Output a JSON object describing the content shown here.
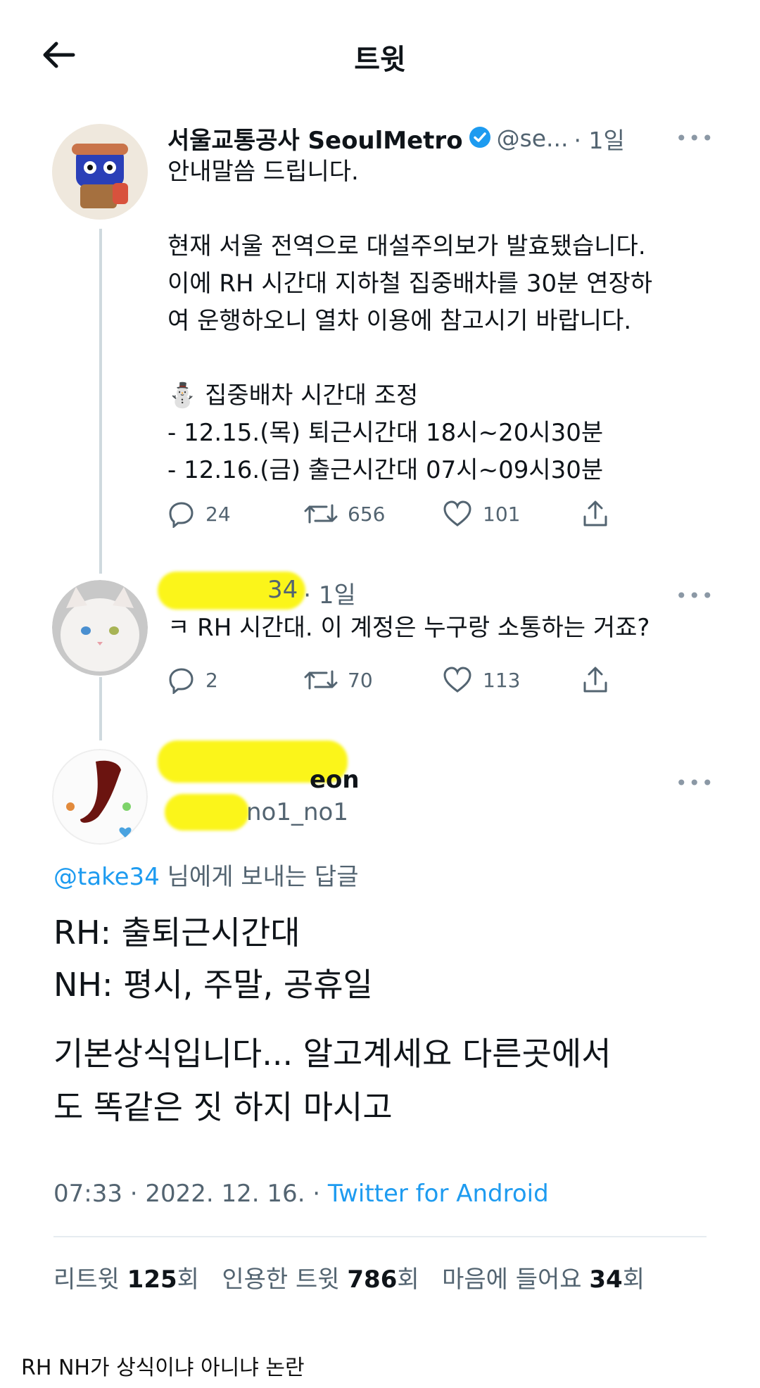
{
  "header": {
    "title": "트윗"
  },
  "tweet1": {
    "display_name": "서울교통공사 SeoulMetro",
    "handle": "@se...",
    "time": "· 1일",
    "more": "•••",
    "text": "안내말씀 드립니다.\n\n현재 서울 전역으로 대설주의보가 발효됐습니다.\n이에 RH 시간대 지하철 집중배차를 30분 연장하\n여 운행하오니 열차 이용에 참고시기 바랍니다.\n\n⛄ 집중배차 시간대 조정\n- 12.15.(목) 퇴근시간대 18시~20시30분\n- 12.16.(금) 출근시간대 07시~09시30분",
    "replies": "24",
    "retweets": "656",
    "likes": "101"
  },
  "tweet2": {
    "handle_visible": "34",
    "time": "· 1일",
    "more": "•••",
    "text": "ㅋ RH 시간대. 이 계정은 누구랑 소통하는 거죠?",
    "replies": "2",
    "retweets": "70",
    "likes": "113"
  },
  "tweet3": {
    "name_visible": "eon",
    "handle_visible": "no1_no1",
    "more": "•••",
    "reply_to_handle": "@take34",
    "reply_to_suffix": " 님에게 보내는 답글",
    "line1": "RH: 출퇴근시간대",
    "line2": "NH: 평시, 주말, 공휴일",
    "line3": "기본상식입니다... 알고계세요 다른곳에서",
    "line4": "도 똑같은 짓 하지 마시고",
    "timestamp": "07:33 · 2022. 12. 16. · ",
    "source": "Twitter for Android",
    "retweet_label": "리트윗 ",
    "retweet_count": "125",
    "retweet_unit": "회",
    "quote_label": "인용한 트윗 ",
    "quote_count": "786",
    "quote_unit": "회",
    "like_label": "마음에 들어요 ",
    "like_count": "34",
    "like_unit": "회"
  },
  "caption": "RH NH가 상식이냐 아니냐 논란",
  "colors": {
    "link": "#1d9bf0",
    "grey": "#536471",
    "verified": "#1d9bf0",
    "highlight": "#fbf51a"
  }
}
